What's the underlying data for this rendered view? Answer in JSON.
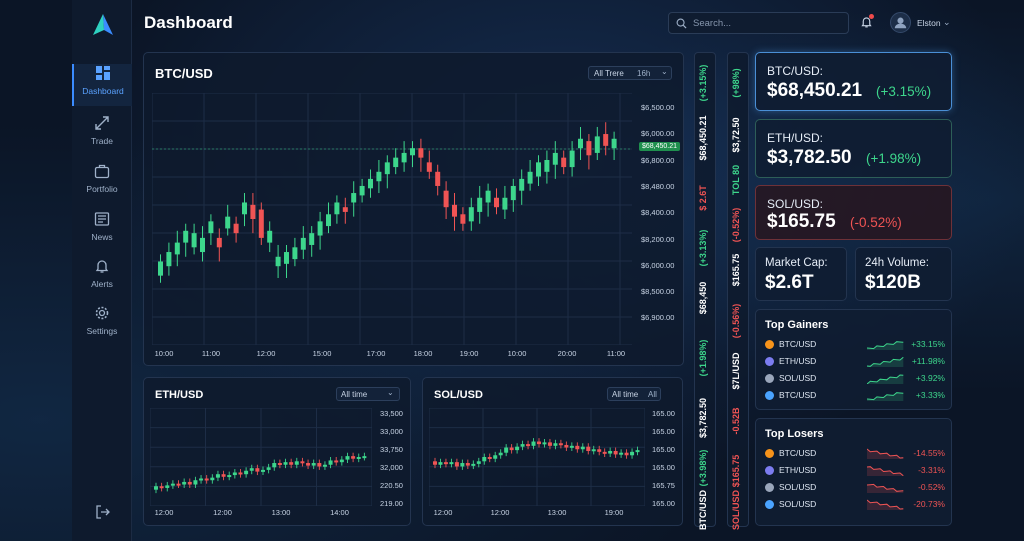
{
  "app": {
    "title": "Dashboard"
  },
  "sidebar": {
    "items": [
      {
        "label": "Dashboard",
        "icon": "grid-icon",
        "active": true
      },
      {
        "label": "Trade",
        "icon": "arrows-icon"
      },
      {
        "label": "Portfolio",
        "icon": "briefcase-icon"
      },
      {
        "label": "News",
        "icon": "newspaper-icon"
      },
      {
        "label": "Alerts",
        "icon": "bell-icon"
      },
      {
        "label": "Settings",
        "icon": "gear-icon"
      }
    ],
    "logout_icon": "logout-icon"
  },
  "header": {
    "search_placeholder": "Search...",
    "user_name": "Elston",
    "notification_dot": true
  },
  "colors": {
    "up": "#3dd68c",
    "down": "#f05454",
    "accent": "#3b8cff",
    "bg": "#0b1526"
  },
  "main_chart": {
    "title": "BTC/USD",
    "range_button": "All Trere",
    "interval": "16h",
    "price_tag": "$68,450.21",
    "y_ticks": [
      "$6,500.00",
      "$6,000.00",
      "$6,800.00",
      "$8,480.00",
      "$8,400.00",
      "$8,200.00",
      "$6,000.00",
      "$8,500.00",
      "$6,900.00"
    ],
    "x_ticks": [
      "10:00",
      "11:00",
      "12:00",
      "15:00",
      "17:00",
      "18:00",
      "19:00",
      "10:00",
      "20:00",
      "11:00"
    ]
  },
  "eth_chart": {
    "title": "ETH/USD",
    "range_button": "All time",
    "y_ticks": [
      "33,500",
      "33,000",
      "33,750",
      "32,000",
      "220.50",
      "219.00"
    ],
    "x_ticks": [
      "12:00",
      "12:00",
      "13:00",
      "14:00"
    ]
  },
  "sol_chart": {
    "title": "SOL/USD",
    "range_button": "All time",
    "interval": "All",
    "y_ticks": [
      "165.00",
      "165.00",
      "165.00",
      "165.00",
      "165.75",
      "165.00"
    ],
    "x_ticks": [
      "12:00",
      "12:00",
      "13:00",
      "19:00"
    ]
  },
  "chart_data": [
    {
      "type": "candlestick",
      "title": "BTC/USD",
      "price_line": "$68,450.21",
      "note": "values in chart-axis units (0 = bottom of visible range, 100 = top)",
      "candles": [
        [
          26,
          32
        ],
        [
          30,
          36
        ],
        [
          35,
          40
        ],
        [
          40,
          45
        ],
        [
          38,
          44
        ],
        [
          36,
          42
        ],
        [
          44,
          49
        ],
        [
          42,
          38
        ],
        [
          46,
          51
        ],
        [
          48,
          44
        ],
        [
          52,
          57
        ],
        [
          56,
          50
        ],
        [
          54,
          42
        ],
        [
          40,
          45
        ],
        [
          30,
          34
        ],
        [
          31,
          36
        ],
        [
          33,
          38
        ],
        [
          37,
          42
        ],
        [
          39,
          44
        ],
        [
          43,
          49
        ],
        [
          47,
          52
        ],
        [
          52,
          57
        ],
        [
          55,
          53
        ],
        [
          57,
          61
        ],
        [
          60,
          64
        ],
        [
          63,
          67
        ],
        [
          66,
          70
        ],
        [
          69,
          74
        ],
        [
          72,
          76
        ],
        [
          74,
          78
        ],
        [
          77,
          80
        ],
        [
          80,
          76
        ],
        [
          74,
          70
        ],
        [
          70,
          64
        ],
        [
          62,
          55
        ],
        [
          56,
          51
        ],
        [
          52,
          48
        ],
        [
          49,
          55
        ],
        [
          53,
          59
        ],
        [
          57,
          62
        ],
        [
          59,
          55
        ],
        [
          54,
          59
        ],
        [
          58,
          64
        ],
        [
          62,
          67
        ],
        [
          65,
          70
        ],
        [
          68,
          74
        ],
        [
          70,
          75
        ],
        [
          73,
          78
        ],
        [
          76,
          72
        ],
        [
          72,
          79
        ],
        [
          80,
          84
        ],
        [
          83,
          77
        ],
        [
          78,
          85
        ],
        [
          86,
          81
        ],
        [
          80,
          84
        ]
      ]
    },
    {
      "type": "candlestick",
      "title": "ETH/USD"
    },
    {
      "type": "candlestick",
      "title": "SOL/USD"
    }
  ],
  "strips": [
    {
      "items": [
        {
          "text": "(+3.15%)",
          "color": "up"
        },
        {
          "text": "$68,450.21",
          "color": "white"
        },
        {
          "text": "$ 2.6T",
          "color": "down"
        },
        {
          "text": "(+3.13%)",
          "color": "up"
        },
        {
          "text": "$68,450",
          "color": "white"
        },
        {
          "text": "(+1.98%)",
          "color": "up"
        },
        {
          "text": "$3,782.50",
          "color": "white"
        },
        {
          "text": "(+3.98%)",
          "color": "up"
        },
        {
          "text": "BTC/USD",
          "color": "white"
        }
      ]
    },
    {
      "items": [
        {
          "text": "(+98%)",
          "color": "up"
        },
        {
          "text": "$3,72.50",
          "color": "white"
        },
        {
          "text": "TOL 80",
          "color": "up"
        },
        {
          "text": "(-0.52%)",
          "color": "down"
        },
        {
          "text": "$165.75",
          "color": "white"
        },
        {
          "text": "(-0.56%)",
          "color": "down"
        },
        {
          "text": "$7L/USD",
          "color": "white"
        },
        {
          "text": "-0.52B",
          "color": "down"
        },
        {
          "text": "$165.75",
          "color": "down"
        },
        {
          "text": "SOL/USD",
          "color": "down"
        }
      ]
    }
  ],
  "tickers": [
    {
      "pair": "BTC/USD:",
      "price": "$68,450.21",
      "change": "(+3.15%)",
      "dir": "up"
    },
    {
      "pair": "ETH/USD:",
      "price": "$3,782.50",
      "change": "(+1.98%)",
      "dir": "up"
    },
    {
      "pair": "SOL/USD:",
      "price": "$165.75",
      "change": "(-0.52%)",
      "dir": "down"
    }
  ],
  "stats": {
    "market_cap_label": "Market Cap:",
    "market_cap": "$2.6T",
    "volume_label": "24h Volume:",
    "volume": "$120B"
  },
  "gainers": {
    "title": "Top Gainers",
    "rows": [
      {
        "name": "BTC/USD",
        "change": "+33.15%",
        "coin": "#f7931a"
      },
      {
        "name": "ETH/USD",
        "change": "+11.98%",
        "coin": "#7c7cf0"
      },
      {
        "name": "SOL/USD",
        "change": "+3.92%",
        "coin": "#9aa6bb"
      },
      {
        "name": "BTC/USD",
        "change": "+3.33%",
        "coin": "#4aa3ff"
      }
    ]
  },
  "losers": {
    "title": "Top Losers",
    "rows": [
      {
        "name": "BTC/USD",
        "change": "-14.55%",
        "coin": "#f7931a"
      },
      {
        "name": "ETH/USD",
        "change": "-3.31%",
        "coin": "#7c7cf0"
      },
      {
        "name": "SOL/USD",
        "change": "-0.52%",
        "coin": "#9aa6bb"
      },
      {
        "name": "SOL/USD",
        "change": "-20.73%",
        "coin": "#4aa3ff"
      }
    ]
  }
}
